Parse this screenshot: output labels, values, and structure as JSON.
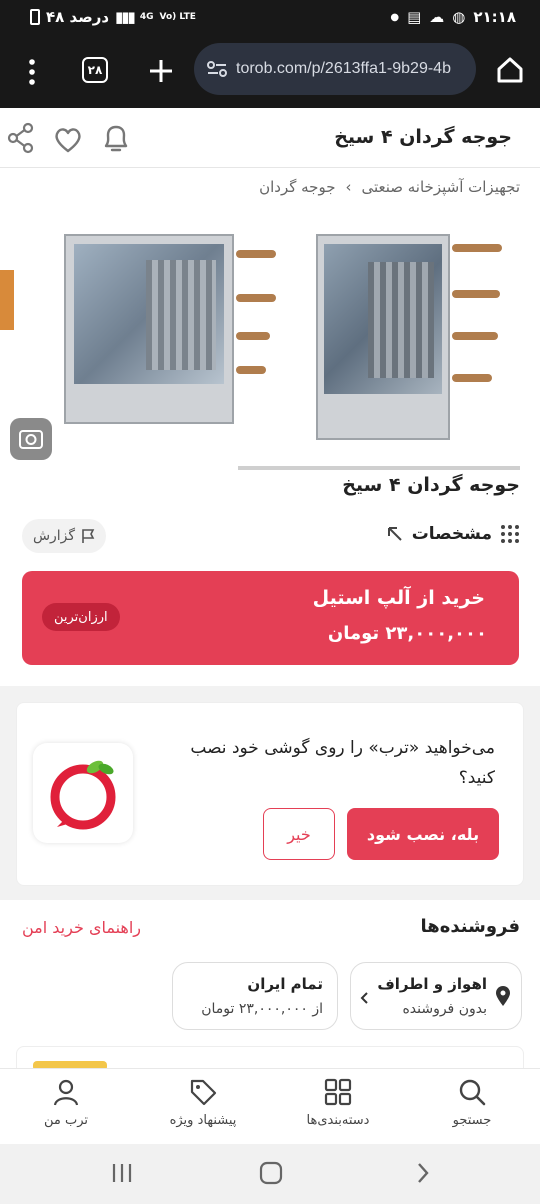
{
  "status": {
    "time": "۲۱:۱۸",
    "battery": "۴۸ درصد",
    "net": "4G",
    "volte": "Vo) LTE"
  },
  "browser": {
    "url": "torob.com/p/2613ffa1-9b29-4b",
    "tabs": "۲۸"
  },
  "header": {
    "title": "جوجه گردان ۴ سیخ"
  },
  "breadcrumb": {
    "item1": "تجهیزات آشپزخانه صنعتی",
    "sep": "›",
    "item2": "جوجه گردان"
  },
  "product": {
    "name": "جوجه گردان ۴ سیخ",
    "specs_label": "مشخصات",
    "report_label": "گزارش"
  },
  "offer": {
    "title": "خرید از آلپ استیل",
    "price": "۲۳,۰۰۰,۰۰۰ تومان",
    "badge": "ارزان‌ترین"
  },
  "install": {
    "question": "می‌خواهید «ترب» را روی گوشی خود نصب کنید؟",
    "yes": "بله، نصب شود",
    "no": "خیر"
  },
  "sellers": {
    "heading": "فروشنده‌ها",
    "guide": "راهنمای خرید امن",
    "local": {
      "title": "اهواز و اطراف",
      "sub": "بدون فروشنده"
    },
    "national": {
      "title": "تمام ایران",
      "sub": "از ۲۳,۰۰۰,۰۰۰ تومان"
    }
  },
  "nav": {
    "search": "جستجو",
    "categories": "دسته‌بندی‌ها",
    "offers": "پیشنهاد ویژه",
    "mine": "ترب من"
  },
  "colors": {
    "accent": "#e43f55"
  }
}
